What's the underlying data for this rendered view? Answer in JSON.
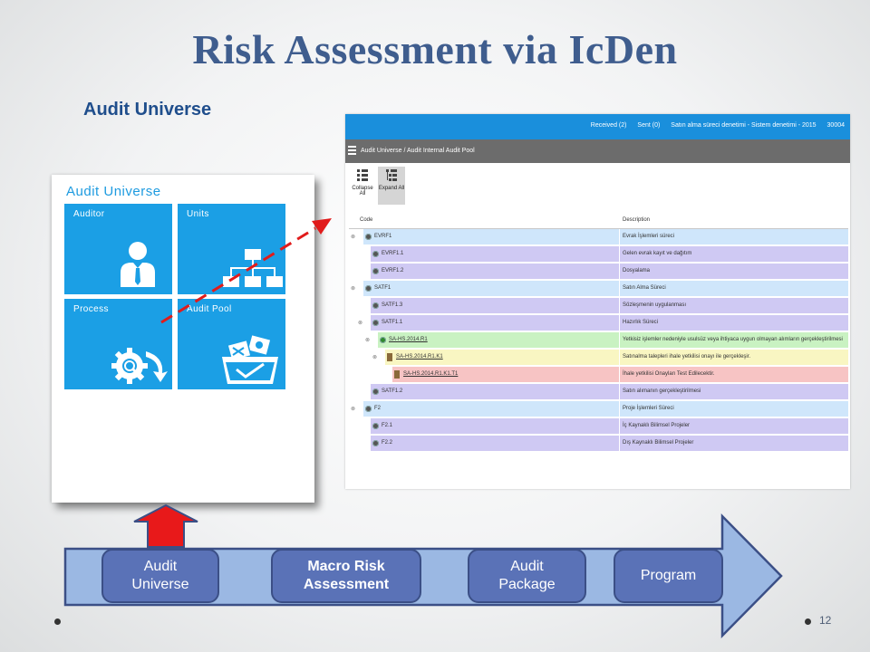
{
  "slide": {
    "title": "Risk Assessment via IcDen",
    "subtitle": "Audit Universe",
    "page_number": "12"
  },
  "panel": {
    "title": "Audit Universe",
    "tiles": [
      {
        "label": "Auditor",
        "icon": "auditor-person-icon"
      },
      {
        "label": "Units",
        "icon": "org-chart-icon"
      },
      {
        "label": "Process",
        "icon": "gear-search-icon"
      },
      {
        "label": "Audit Pool",
        "icon": "basket-icon"
      }
    ]
  },
  "screenshot": {
    "topbar": {
      "received": "Received (2)",
      "sent": "Sent (0)",
      "context": "Satın alma süreci denetimi - Sistem denetimi - 2015",
      "code": "30004"
    },
    "breadcrumb": "Audit Universe / Audit Internal Audit Pool",
    "toolbar": {
      "collapse_all": "Collapse All",
      "expand_all": "Expand All"
    },
    "grid": {
      "headers": {
        "code": "Code",
        "description": "Description"
      },
      "rows": [
        {
          "code": "EVRF1",
          "description": "Evrak İşlemleri süreci",
          "level": 0,
          "color": "#cfe6fb",
          "toggle": "⊗",
          "icon": "gear"
        },
        {
          "code": "EVRF1.1",
          "description": "Gelen evrak kayıt ve dağıtım",
          "level": 1,
          "color": "#cfc9f3",
          "toggle": "",
          "icon": "gear"
        },
        {
          "code": "EVRF1.2",
          "description": "Dosyalama",
          "level": 1,
          "color": "#cfc9f3",
          "toggle": "",
          "icon": "gear"
        },
        {
          "code": "SATF1",
          "description": "Satın Alma Süreci",
          "level": 0,
          "color": "#cfe6fb",
          "toggle": "⊗",
          "icon": "gear"
        },
        {
          "code": "SATF1.3",
          "description": "Sözleşmenin uygulanması",
          "level": 1,
          "color": "#cfc9f3",
          "toggle": "",
          "icon": "gear"
        },
        {
          "code": "SATF1.1",
          "description": "Hazırlık Süreci",
          "level": 1,
          "color": "#cfc9f3",
          "toggle": "⊗",
          "icon": "gear"
        },
        {
          "code": "SA-HS.2014.R1",
          "description": "Yetkisiz işlemler nedeniyle usulsüz veya ihtiyaca uygun olmayan alımların gerçekleştirilmesi",
          "level": 2,
          "color": "#c9f2c2",
          "toggle": "⊗",
          "icon": "leaf"
        },
        {
          "code": "SA-HS.2014.R1.K1",
          "description": "Satınalma talepleri ihale yetkilisi onayı ile gerçekleşir.",
          "level": 3,
          "color": "#f9f6c2",
          "toggle": "⊗",
          "icon": "doc"
        },
        {
          "code": "SA-HS.2014.R1.K1.T1",
          "description": "İhale yetkilisi Onayları Test Edilecektir.",
          "level": 4,
          "color": "#f7c4c4",
          "toggle": "",
          "icon": "doc"
        },
        {
          "code": "SATF1.2",
          "description": "Satın alımanın gerçekleştirilmesi",
          "level": 1,
          "color": "#cfc9f3",
          "toggle": "",
          "icon": "gear"
        },
        {
          "code": "F2",
          "description": "Proje İşlemleri Süreci",
          "level": 0,
          "color": "#cfe6fb",
          "toggle": "⊗",
          "icon": "gear"
        },
        {
          "code": "F2.1",
          "description": "İç Kaynaklı Bilimsel Projeler",
          "level": 1,
          "color": "#cfc9f3",
          "toggle": "",
          "icon": "gear"
        },
        {
          "code": "F2.2",
          "description": "Dış Kaynaklı Bilimsel Projeler",
          "level": 1,
          "color": "#cfc9f3",
          "toggle": "",
          "icon": "gear"
        }
      ]
    }
  },
  "process_steps": [
    {
      "label": "Audit\nUniverse",
      "bold": false
    },
    {
      "label": "Macro Risk\nAssessment",
      "bold": true
    },
    {
      "label": "Audit\nPackage",
      "bold": false
    },
    {
      "label": "Program",
      "bold": false
    }
  ],
  "colors": {
    "title": "#3f5d8e",
    "tile": "#1b9fe5",
    "topbar": "#1a8fdc",
    "flow_arrow": "#9bb8e3",
    "step": "#5a72b7",
    "pointer_arrow": "#e11b1b"
  }
}
